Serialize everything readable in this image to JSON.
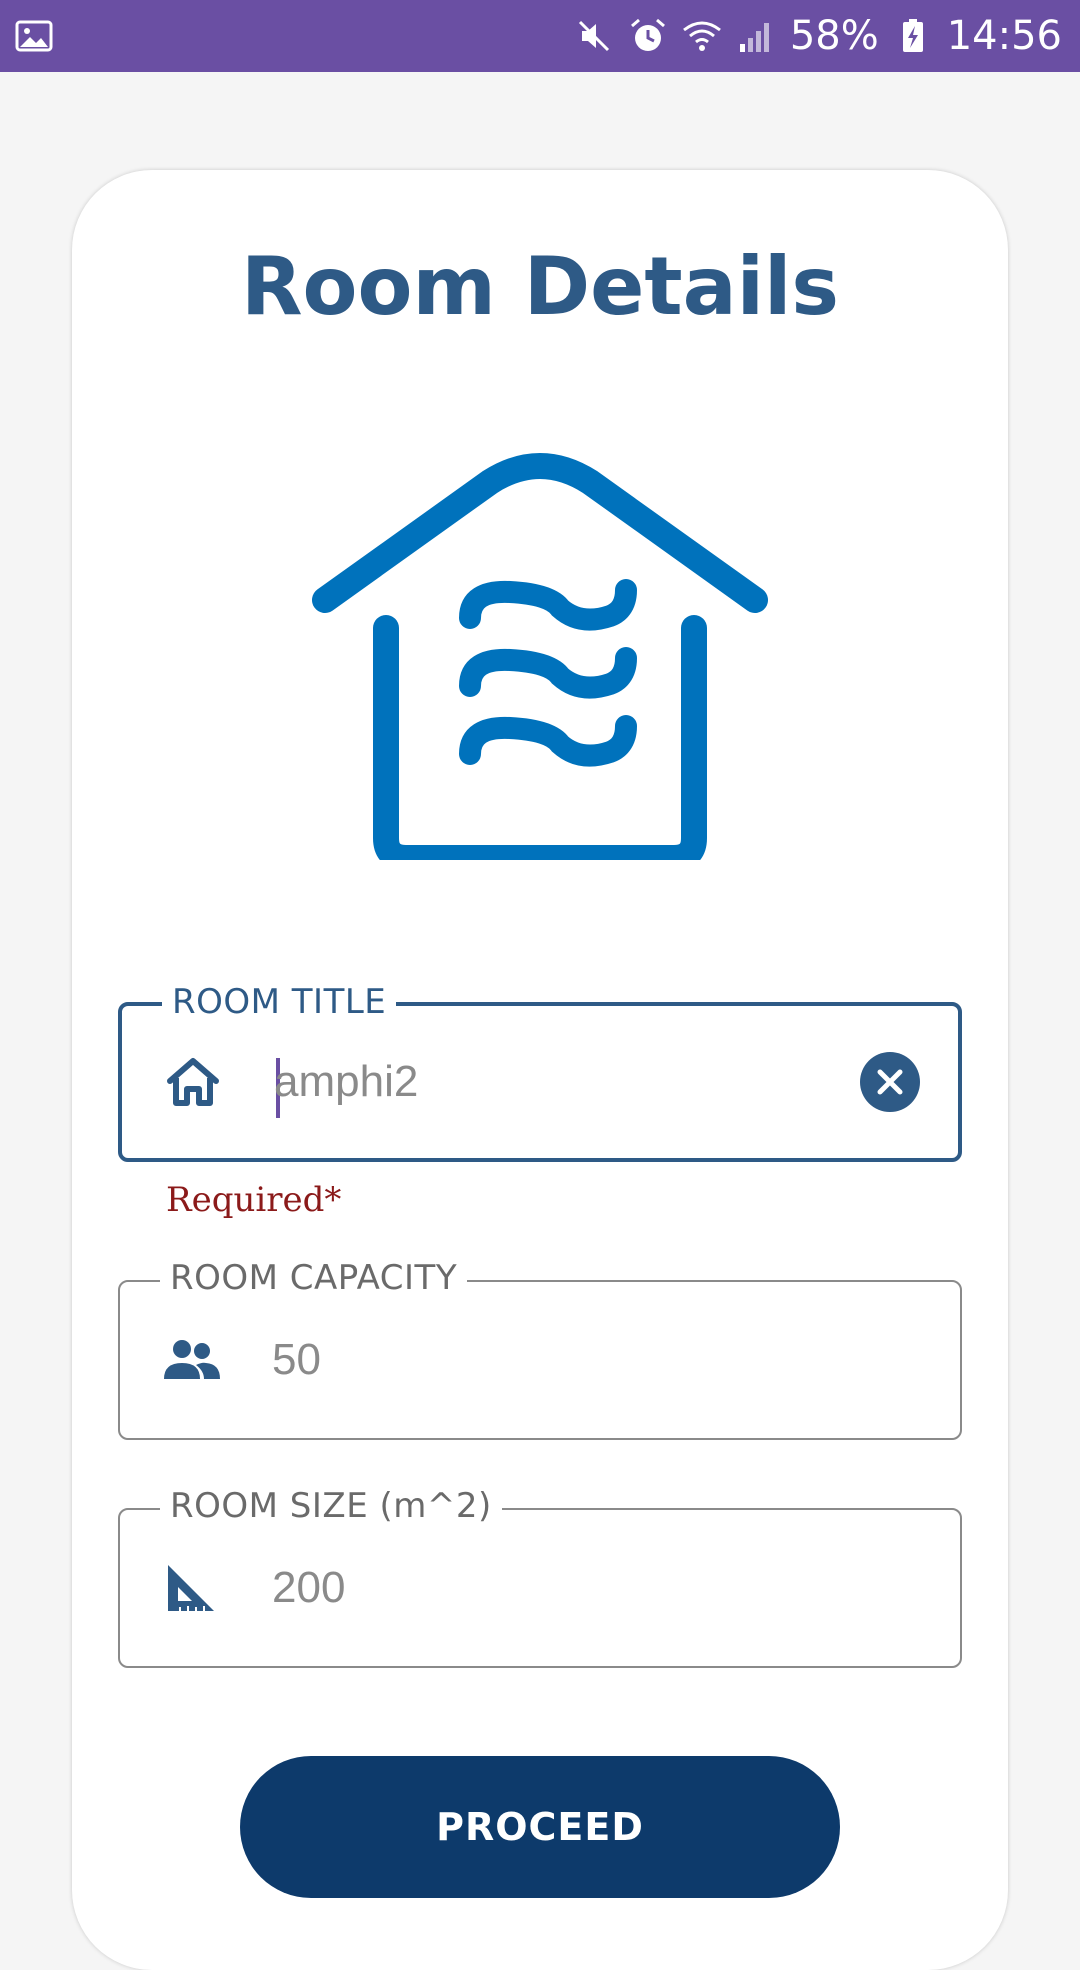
{
  "status_bar": {
    "battery": "58%",
    "time": "14:56",
    "icons": [
      "image-icon",
      "mute-icon",
      "alarm-icon",
      "wifi-icon",
      "signal-icon",
      "battery-charging-icon"
    ]
  },
  "page": {
    "title": "Room Details",
    "hero_icon": "house-waves-icon"
  },
  "form": {
    "room_title": {
      "label": "ROOM TITLE",
      "value": "amphi2",
      "icon": "home-icon",
      "error": "Required*"
    },
    "room_capacity": {
      "label": "ROOM CAPACITY",
      "value": "50",
      "icon": "people-icon"
    },
    "room_size": {
      "label": "ROOM SIZE (m^2)",
      "value": "200",
      "icon": "set-square-icon"
    },
    "proceed_label": "PROCEED"
  },
  "colors": {
    "status_bar": "#6a4fa3",
    "primary": "#2e5a86",
    "button": "#0d3a6b",
    "hero": "#0072bc",
    "error": "#8b1a1a"
  }
}
